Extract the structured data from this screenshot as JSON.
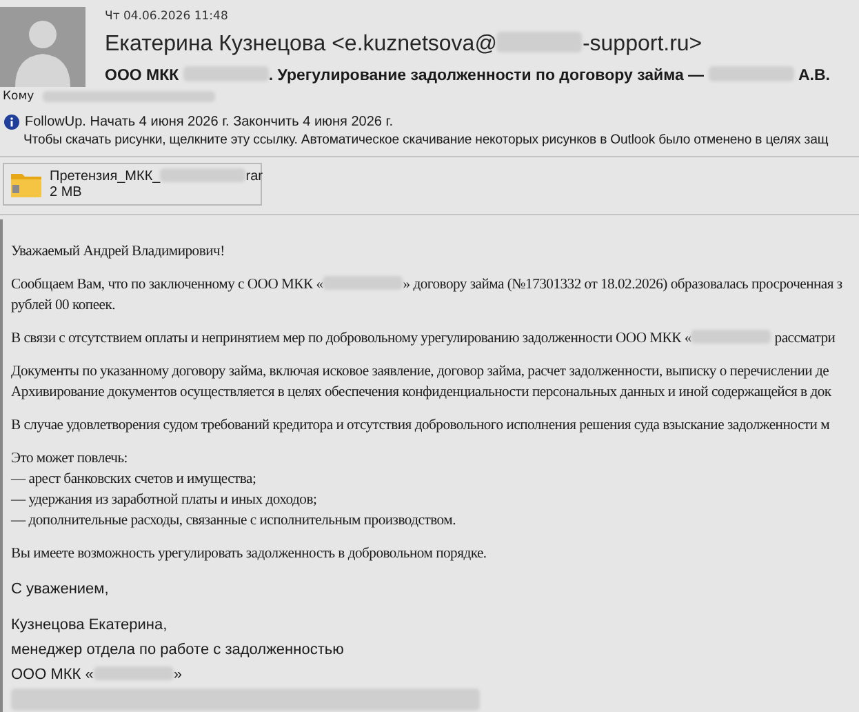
{
  "header": {
    "date": "Чт 04.06.2026 11:48",
    "sender": [
      {
        "kind": "text",
        "text": "Екатерина Кузнецова <e.kuznetsova@"
      },
      {
        "kind": "redacted"
      },
      {
        "kind": "text",
        "text": "-support.ru>"
      }
    ],
    "subject": [
      {
        "kind": "text",
        "text": "ООО МКК "
      },
      {
        "kind": "redacted"
      },
      {
        "kind": "text",
        "text": ". Урегулирование задолженности по договору займа — "
      },
      {
        "kind": "redacted"
      },
      {
        "kind": "text",
        "text": " А.В."
      }
    ],
    "to": {
      "label": "Кому",
      "recipient": [
        {
          "kind": "redacted-line"
        }
      ]
    },
    "followup": "FollowUp.  Начать 4 июня 2026 г.  Закончить 4 июня 2026 г.",
    "notice": "Чтобы скачать рисунки, щелкните эту ссылку. Автоматическое скачивание некоторых рисунков в Outlook было отменено в целях защ"
  },
  "attachment": {
    "name": [
      {
        "kind": "text",
        "text": "Претензия_МКК_"
      },
      {
        "kind": "redacted"
      },
      {
        "kind": "text",
        "text": "rar"
      }
    ],
    "size": "2 MB"
  },
  "body": [
    {
      "kind": "serif",
      "lines": [
        [
          {
            "kind": "text",
            "text": "Уважаемый Андрей Владимирович!"
          }
        ]
      ]
    },
    {
      "kind": "serif",
      "lines": [
        [
          {
            "kind": "text",
            "text": "Сообщаем Вам, что по заключенному с ООО МКК «"
          },
          {
            "kind": "redacted"
          },
          {
            "kind": "text",
            "text": "» договору займа (№17301332 от 18.02.2026) образовалась просроченная з"
          }
        ],
        [
          {
            "kind": "text",
            "text": "рублей 00 копеек."
          }
        ]
      ]
    },
    {
      "kind": "serif",
      "lines": [
        [
          {
            "kind": "text",
            "text": "В связи с отсутствием оплаты и непринятием мер по добровольному урегулированию задолженности ООО МКК «"
          },
          {
            "kind": "redacted"
          },
          {
            "kind": "text",
            "text": " рассматри"
          }
        ]
      ]
    },
    {
      "kind": "serif",
      "lines": [
        [
          {
            "kind": "text",
            "text": "Документы по указанному договору займа, включая исковое заявление, договор займа, расчет задолженности, выписку о перечислении де"
          }
        ],
        [
          {
            "kind": "text",
            "text": "Архивирование документов осуществляется в целях обеспечения конфиденциальности персональных данных и иной содержащейся в док"
          }
        ]
      ]
    },
    {
      "kind": "serif",
      "lines": [
        [
          {
            "kind": "text",
            "text": "В случае удовлетворения судом требований кредитора и отсутствия добровольного исполнения решения суда взыскание задолженности м"
          }
        ]
      ]
    },
    {
      "kind": "serif",
      "lines": [
        [
          {
            "kind": "text",
            "text": "Это может повлечь:"
          }
        ],
        [
          {
            "kind": "text",
            "text": "— арест банковских счетов и имущества;"
          }
        ],
        [
          {
            "kind": "text",
            "text": "— удержания из заработной платы и иных доходов;"
          }
        ],
        [
          {
            "kind": "text",
            "text": "— дополнительные расходы, связанные с исполнительным производством."
          }
        ]
      ]
    },
    {
      "kind": "serif",
      "lines": [
        [
          {
            "kind": "text",
            "text": "Вы имеете возможность урегулировать задолженность в добровольном порядке."
          }
        ]
      ]
    },
    {
      "kind": "sans",
      "lines": [
        [
          {
            "kind": "text",
            "text": "С уважением,"
          }
        ]
      ]
    },
    {
      "kind": "sans",
      "lines": [
        [
          {
            "kind": "text",
            "text": "Кузнецова Екатерина,"
          }
        ],
        [
          {
            "kind": "text",
            "text": "менеджер отдела по работе с задолженностью"
          }
        ],
        [
          {
            "kind": "text",
            "text": "ООО МКК «"
          },
          {
            "kind": "redacted"
          },
          {
            "kind": "text",
            "text": "»"
          }
        ],
        [
          {
            "kind": "redacted-line"
          }
        ]
      ]
    }
  ]
}
